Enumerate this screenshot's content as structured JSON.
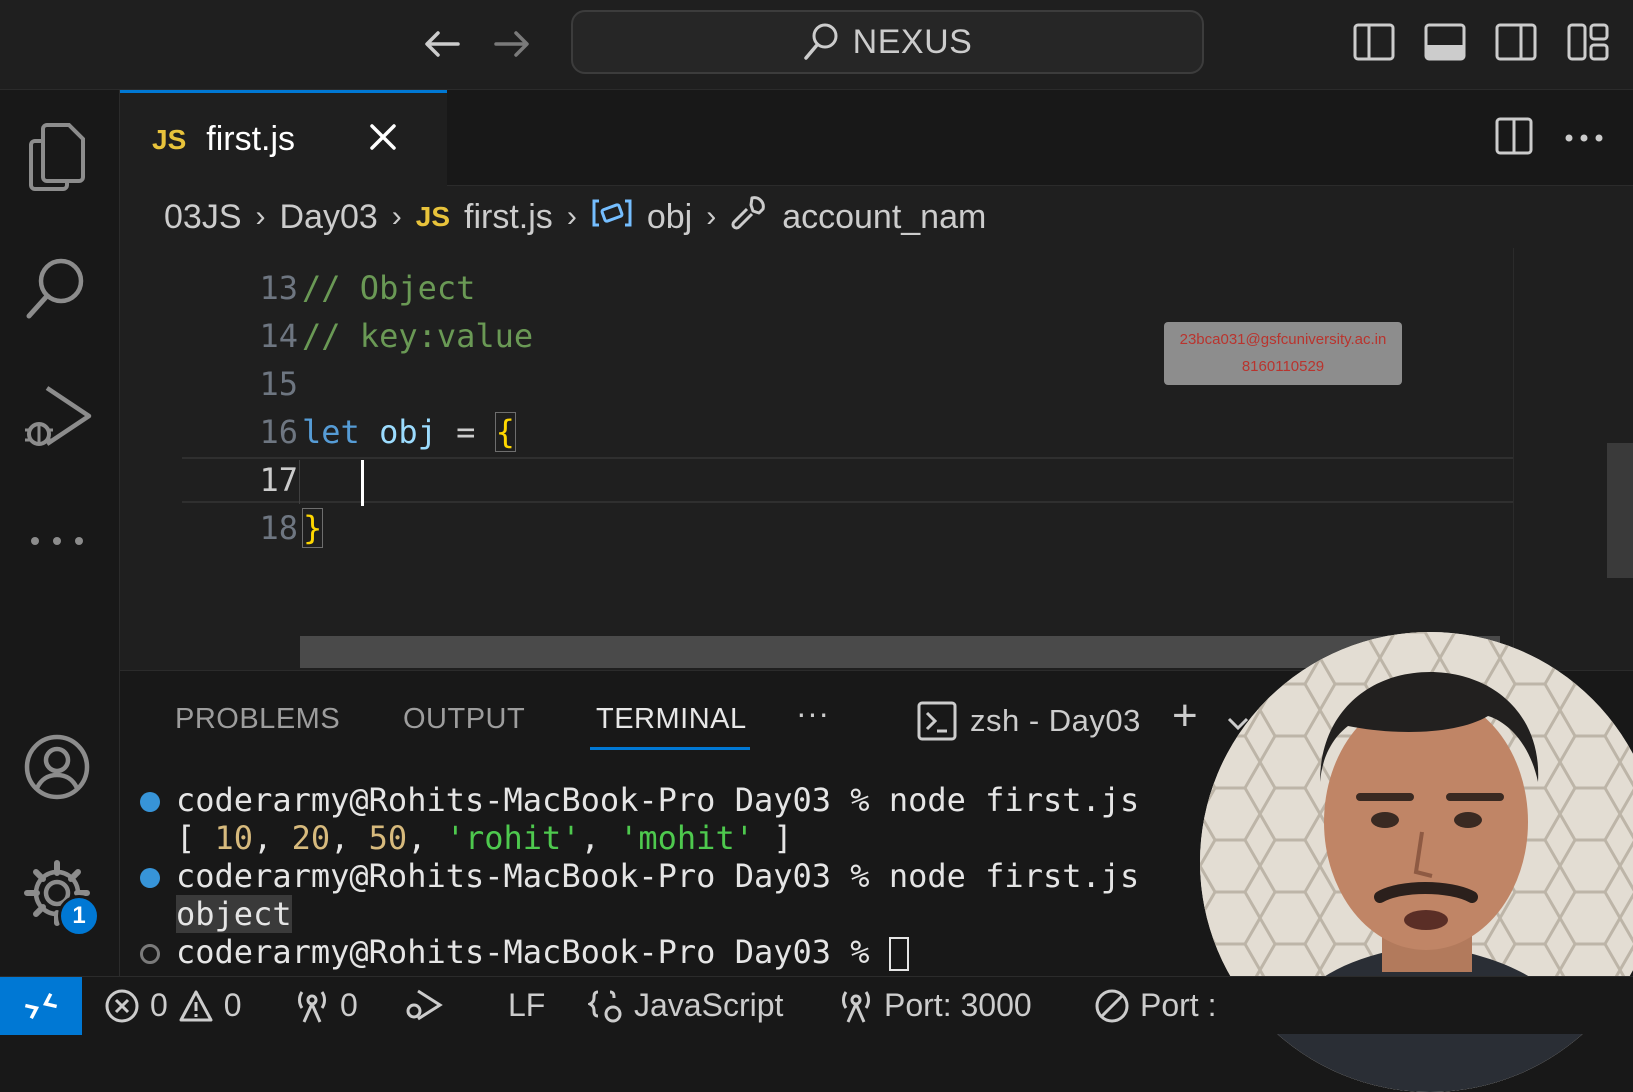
{
  "search": {
    "label": "NEXUS"
  },
  "tab": {
    "lang_badge": "JS",
    "filename": "first.js"
  },
  "breadcrumb": {
    "items": [
      "03JS",
      "Day03",
      "first.js",
      "obj",
      "account_nam"
    ],
    "js_badge": "JS"
  },
  "editor": {
    "lines": [
      {
        "num": "13",
        "text": "// Object"
      },
      {
        "num": "14",
        "text": "// key:value"
      },
      {
        "num": "15",
        "text": ""
      },
      {
        "num": "16",
        "kw": "let",
        "name": "obj",
        "op": " = ",
        "brace": "{"
      },
      {
        "num": "17",
        "text": ""
      },
      {
        "num": "18",
        "brace": "}"
      }
    ]
  },
  "overlay": {
    "email": "23bca031@gsfcuniversity.ac.in",
    "phone": "8160110529"
  },
  "panel": {
    "tabs": [
      "PROBLEMS",
      "OUTPUT",
      "TERMINAL"
    ],
    "more": "···",
    "shell": "zsh - Day03",
    "add": "+"
  },
  "terminal": {
    "prompt1": "coderarmy@Rohits-MacBook-Pro Day03 % node first.js",
    "out1_open": "[ ",
    "out1_n1": "10",
    "out1_n2": "20",
    "out1_n3": "50",
    "out1_s1": "'rohit'",
    "out1_s2": "'mohit'",
    "out1_close": " ]",
    "prompt2": "coderarmy@Rohits-MacBook-Pro Day03 % node first.js",
    "out2": "object",
    "prompt3": "coderarmy@Rohits-MacBook-Pro Day03 % "
  },
  "statusbar": {
    "errors": "0",
    "warnings": "0",
    "ports_count": "0",
    "eol": "LF",
    "language": "JavaScript",
    "port": "Port: 3000",
    "port2": "Port :"
  },
  "settings_badge": "1",
  "colors": {
    "accent": "#0078d4",
    "js_yellow": "#e8c33b",
    "comment": "#6a9955",
    "keyword": "#569cd6"
  }
}
